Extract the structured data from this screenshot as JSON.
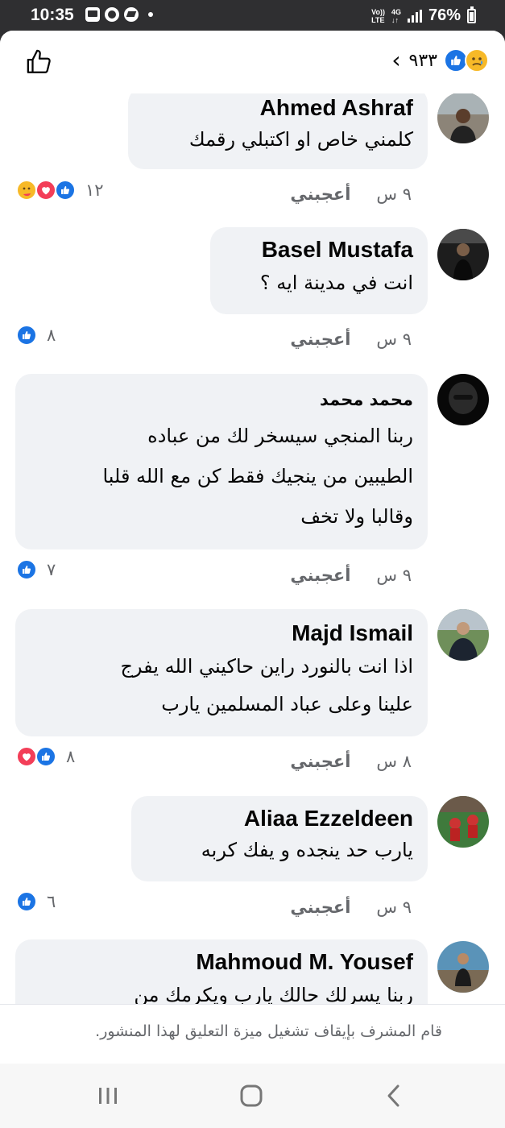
{
  "status": {
    "time": "10:35",
    "network_top": "Vo))",
    "network_bottom": "LTE",
    "network_type_top": "4G",
    "network_type_bottom": "↓↑",
    "battery": "76%"
  },
  "header": {
    "reaction_count": "٩٣٣",
    "back_icon": "chevron-left",
    "like_icon": "thumbs-up-outline"
  },
  "comments": [
    {
      "name": "Ahmed Ashraf",
      "lines": [
        "كلمني خاص او اكتبلي رقمك"
      ],
      "time": "٩ س",
      "like_label": "أعجبني",
      "reactions": "١٢",
      "reaction_types": [
        "like",
        "love",
        "care"
      ]
    },
    {
      "name": "Basel Mustafa",
      "lines": [
        "انت في مدينة ايه ؟"
      ],
      "time": "٩ س",
      "like_label": "أعجبني",
      "reactions": "٨",
      "reaction_types": [
        "like"
      ]
    },
    {
      "name": "محمد محمد",
      "lines": [
        "ربنا المنجي سيسخر لك من عباده",
        "الطيبين من ينجيك فقط كن مع الله قلبا",
        "وقالبا ولا تخف"
      ],
      "time": "٩ س",
      "like_label": "أعجبني",
      "reactions": "٧",
      "reaction_types": [
        "like"
      ]
    },
    {
      "name": "Majd Ismail",
      "lines": [
        "اذا انت بالنورد راين حاكيني الله يفرج",
        "علينا وعلى عباد المسلمين يارب"
      ],
      "time": "٨ س",
      "like_label": "أعجبني",
      "reactions": "٨",
      "reaction_types": [
        "like",
        "love"
      ]
    },
    {
      "name": "Aliaa Ezzeldeen",
      "lines": [
        "يارب حد ينجده و يفك كربه"
      ],
      "time": "٩ س",
      "like_label": "أعجبني",
      "reactions": "٦",
      "reaction_types": [
        "like"
      ]
    },
    {
      "name": "Mahmoud M. Yousef",
      "lines": [
        "ربنا يسرلك حالك يارب ويكرمك من"
      ],
      "time": "",
      "like_label": "",
      "reactions": "",
      "reaction_types": []
    }
  ],
  "footer_note": "قام المشرف بإيقاف تشغيل ميزة التعليق لهذا المنشور.",
  "colors": {
    "like_blue": "#1b74e4",
    "love_red": "#f33e58",
    "care_yellow": "#f7b928",
    "bubble": "#f0f2f5",
    "muted": "#65676b"
  }
}
